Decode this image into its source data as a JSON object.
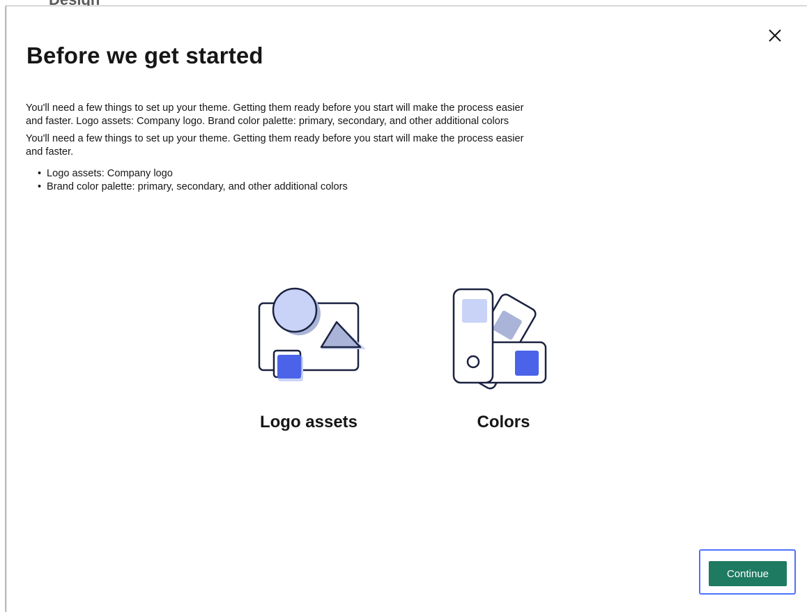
{
  "background": {
    "partial_title": "Design"
  },
  "dialog": {
    "title": "Before we get started",
    "paragraph_1": "You'll need a few things to set up your theme. Getting them ready before you start will make the process easier and faster. Logo assets: Company logo. Brand color palette: primary, secondary, and other additional colors",
    "paragraph_2": "You'll need a few things to set up your theme. Getting them ready before you start will make the process easier and faster.",
    "list_items": [
      "Logo assets: Company logo",
      "Brand color palette: primary, secondary, and other additional colors"
    ],
    "cards": [
      {
        "icon": "logo-assets-icon",
        "label": "Logo assets"
      },
      {
        "icon": "color-swatches-icon",
        "label": "Colors"
      }
    ],
    "close_icon": "close-icon",
    "continue_label": "Continue"
  },
  "colors": {
    "primary_button": "#1f7a62",
    "focus_ring": "#4c73ff",
    "illustration_outline": "#1b2240",
    "illustration_accent": "#4a63e8",
    "illustration_light": "#c9d3f7",
    "illustration_mid": "#aab4d8"
  }
}
